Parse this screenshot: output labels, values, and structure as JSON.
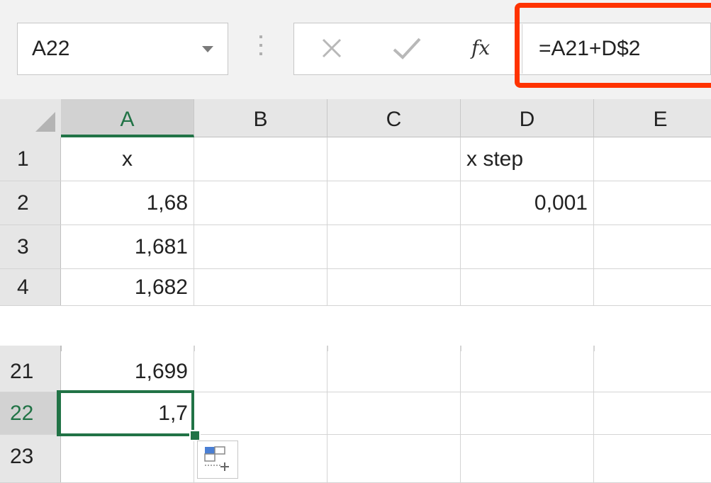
{
  "formula_bar": {
    "name_box": "A22",
    "formula": "=A21+D$2",
    "fx_label": "fx",
    "highlight_color": "#ff3300"
  },
  "columns": [
    "A",
    "B",
    "C",
    "D",
    "E"
  ],
  "active_column": "A",
  "rows_top": [
    {
      "num": "1",
      "A": "x",
      "D": "x step"
    },
    {
      "num": "2",
      "A": "1,68",
      "D": "0,001"
    },
    {
      "num": "3",
      "A": "1,681",
      "D": ""
    },
    {
      "num": "4",
      "A": "1,682",
      "D": ""
    }
  ],
  "rows_bottom": [
    {
      "num": "21",
      "A": "1,699"
    },
    {
      "num": "22",
      "A": "1,7"
    },
    {
      "num": "23",
      "A": ""
    }
  ],
  "selected_cell": "A22",
  "accent_color": "#217346",
  "icons": [
    "cancel-icon",
    "enter-icon",
    "fx-icon",
    "autofill-options-icon"
  ]
}
